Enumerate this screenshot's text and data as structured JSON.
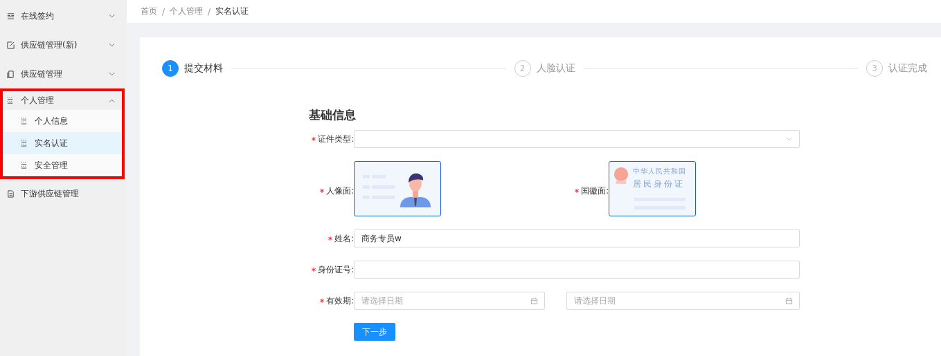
{
  "sidebar": {
    "items": [
      {
        "label": "在线签约",
        "expanded": false,
        "highlighted": false
      },
      {
        "label": "供应链管理(新)",
        "expanded": false,
        "highlighted": false
      },
      {
        "label": "供应链管理",
        "expanded": false,
        "highlighted": false
      },
      {
        "label": "个人管理",
        "expanded": true,
        "highlighted": true,
        "children": [
          {
            "label": "个人信息",
            "selected": false
          },
          {
            "label": "实名认证",
            "selected": true
          },
          {
            "label": "安全管理",
            "selected": false
          }
        ]
      },
      {
        "label": "下游供应链管理",
        "highlighted": false
      }
    ]
  },
  "breadcrumb": {
    "separator": "/",
    "items": [
      "首页",
      "个人管理",
      "实名认证"
    ]
  },
  "steps": [
    {
      "number": "1",
      "label": "提交材料",
      "selected": true
    },
    {
      "number": "2",
      "label": "人脸认证",
      "selected": false
    },
    {
      "number": "3",
      "label": "认证完成",
      "selected": false
    }
  ],
  "form": {
    "title": "基础信息",
    "id_type": {
      "label": "证件类型:",
      "required": true
    },
    "uploads": [
      {
        "label": "人像面:",
        "required": true,
        "kind": "portrait"
      },
      {
        "label": "国徽面:",
        "required": true,
        "kind": "emblem",
        "lines": [
          "中华人民共和国",
          "居民身份证"
        ]
      }
    ],
    "name": {
      "label": "姓名:",
      "required": true,
      "value": "商务专员w"
    },
    "id_number": {
      "label": "身份证号:",
      "required": true
    },
    "validity": {
      "label": "有效期:",
      "required": true,
      "placeholders": [
        "请选择日期",
        "请选择日期"
      ]
    },
    "next_button": "下一步"
  }
}
